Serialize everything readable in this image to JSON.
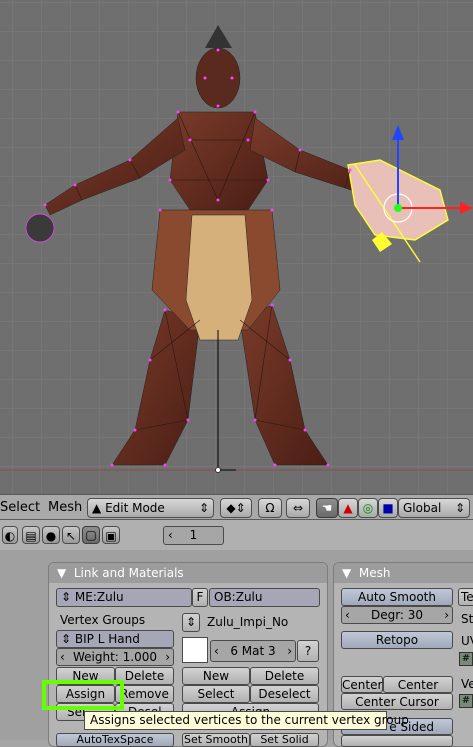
{
  "header": {
    "menu_select": "Select",
    "menu_mesh": "Mesh",
    "mode_dropdown": "Edit Mode",
    "orientation_dropdown": "Global"
  },
  "toolbar2": {
    "frame_value": "1"
  },
  "link_panel": {
    "title": "Link and Materials",
    "me_field": "ME:Zulu",
    "f_button": "F",
    "ob_field": "OB:Zulu",
    "vertex_groups_label": "Vertex Groups",
    "vertex_group_name": "BIP L Hand",
    "weight_label": "Weight: 1.000",
    "new_button": "New",
    "delete_button": "Delete",
    "assign_button": "Assign",
    "remove_button": "Remove",
    "select_button_partial": "Sel",
    "deselect_button_partial": "Desel",
    "material_name": "Zulu_Impi_No",
    "material_slot": "6 Mat 3",
    "question_button": "?",
    "mat_new_button": "New",
    "mat_delete_button": "Delete",
    "mat_select_button": "Select",
    "mat_deselect_button": "Deselect",
    "mat_assign_button": "Assign",
    "autotex_partial": "AutoTexSpace",
    "set_smooth_partial": "Set Smooth",
    "set_solid_partial": "Set Solid"
  },
  "mesh_panel": {
    "title": "Mesh",
    "auto_smooth_button": "Auto Smooth",
    "degr_field": "Degr: 30",
    "retopo_button": "Retopo",
    "center_button": "Center",
    "center_new_button": "Center New",
    "center_cursor_button": "Center Cursor",
    "double_sided_partial": "e Sided",
    "te_partial": "Te",
    "st_partial": "St",
    "uv_partial": "UV",
    "ve_partial": "Ve"
  },
  "tooltip": "Assigns selected vertices to the current vertex group",
  "colors": {
    "viewport_bg": "#6f6f6f",
    "grid_line": "#7d7d7d",
    "vertex_color": "#ff40ff",
    "selected_mesh": "#ffff30",
    "highlight_box": "#66ff00",
    "tooltip_bg": "#fffdd9"
  },
  "icons": [
    "view3d-icon",
    "pivot-icon",
    "proportional-icon",
    "snap-icon",
    "hand-icon",
    "translate-icon",
    "rotate-icon",
    "scale-icon",
    "layer-icon",
    "lamp-icon",
    "camera-icon",
    "wire-icon"
  ]
}
